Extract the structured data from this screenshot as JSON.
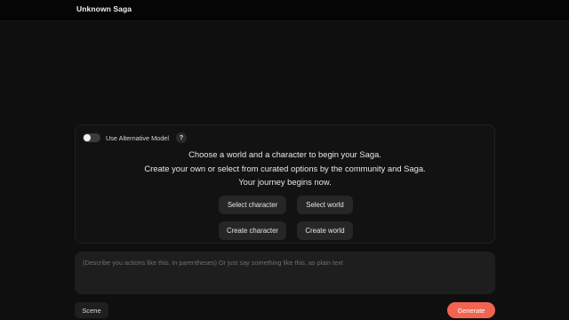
{
  "app": {
    "title": "Unknown Saga"
  },
  "settings": {
    "alt_model_label": "Use Alternative Model",
    "alt_model_enabled": false,
    "help_glyph": "?"
  },
  "intro": {
    "line1": "Choose a world and a character to begin your Saga.",
    "line2": "Create your own or select from curated options by the community and Saga.",
    "line3": "Your journey begins now."
  },
  "actions": {
    "select_character": "Select character",
    "select_world": "Select world",
    "create_character": "Create character",
    "create_world": "Create world"
  },
  "composer": {
    "placeholder": "(Describe you actions like this, in parentheses) Or just say something like this, as plain text",
    "value": ""
  },
  "footer": {
    "scene_label": "Scene",
    "generate_label": "Generate"
  },
  "colors": {
    "background": "#0f0f0f",
    "accent": "#f26450"
  }
}
